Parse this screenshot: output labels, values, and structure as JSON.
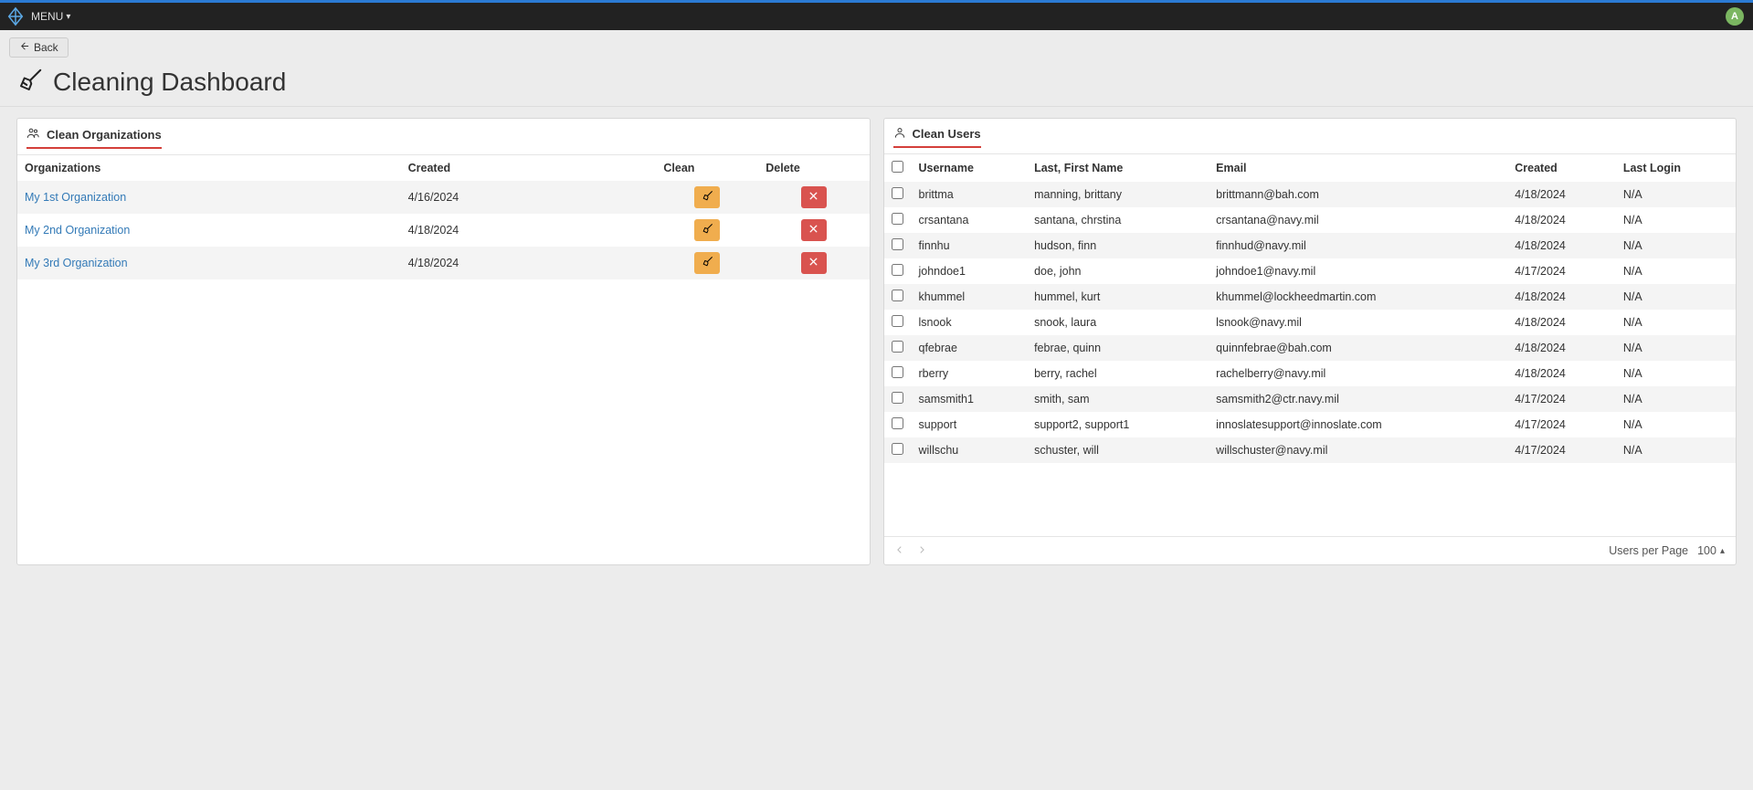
{
  "header": {
    "menu_label": "MENU",
    "avatar_letter": "A"
  },
  "back_label": "Back",
  "page_title": "Cleaning Dashboard",
  "orgs_panel": {
    "title": "Clean Organizations",
    "columns": {
      "org": "Organizations",
      "created": "Created",
      "clean": "Clean",
      "delete": "Delete"
    },
    "rows": [
      {
        "name": "My 1st Organization",
        "created": "4/16/2024"
      },
      {
        "name": "My 2nd Organization",
        "created": "4/18/2024"
      },
      {
        "name": "My 3rd Organization",
        "created": "4/18/2024"
      }
    ]
  },
  "users_panel": {
    "title": "Clean Users",
    "columns": {
      "username": "Username",
      "lastfirst": "Last, First Name",
      "email": "Email",
      "created": "Created",
      "lastlogin": "Last Login"
    },
    "rows": [
      {
        "username": "brittma",
        "lastfirst": "manning, brittany",
        "email": "brittmann@bah.com",
        "created": "4/18/2024",
        "lastlogin": "N/A"
      },
      {
        "username": "crsantana",
        "lastfirst": "santana, chrstina",
        "email": "crsantana@navy.mil",
        "created": "4/18/2024",
        "lastlogin": "N/A"
      },
      {
        "username": "finnhu",
        "lastfirst": "hudson, finn",
        "email": "finnhud@navy.mil",
        "created": "4/18/2024",
        "lastlogin": "N/A"
      },
      {
        "username": "johndoe1",
        "lastfirst": "doe, john",
        "email": "johndoe1@navy.mil",
        "created": "4/17/2024",
        "lastlogin": "N/A"
      },
      {
        "username": "khummel",
        "lastfirst": "hummel, kurt",
        "email": "khummel@lockheedmartin.com",
        "created": "4/18/2024",
        "lastlogin": "N/A"
      },
      {
        "username": "lsnook",
        "lastfirst": "snook, laura",
        "email": "lsnook@navy.mil",
        "created": "4/18/2024",
        "lastlogin": "N/A"
      },
      {
        "username": "qfebrae",
        "lastfirst": "febrae, quinn",
        "email": "quinnfebrae@bah.com",
        "created": "4/18/2024",
        "lastlogin": "N/A"
      },
      {
        "username": "rberry",
        "lastfirst": "berry, rachel",
        "email": "rachelberry@navy.mil",
        "created": "4/18/2024",
        "lastlogin": "N/A"
      },
      {
        "username": "samsmith1",
        "lastfirst": "smith, sam",
        "email": "samsmith2@ctr.navy.mil",
        "created": "4/17/2024",
        "lastlogin": "N/A"
      },
      {
        "username": "support",
        "lastfirst": "support2, support1",
        "email": "innoslatesupport@innoslate.com",
        "created": "4/17/2024",
        "lastlogin": "N/A"
      },
      {
        "username": "willschu",
        "lastfirst": "schuster, will",
        "email": "willschuster@navy.mil",
        "created": "4/17/2024",
        "lastlogin": "N/A"
      }
    ],
    "footer": {
      "per_page_label": "Users per Page",
      "per_page_value": "100"
    }
  }
}
